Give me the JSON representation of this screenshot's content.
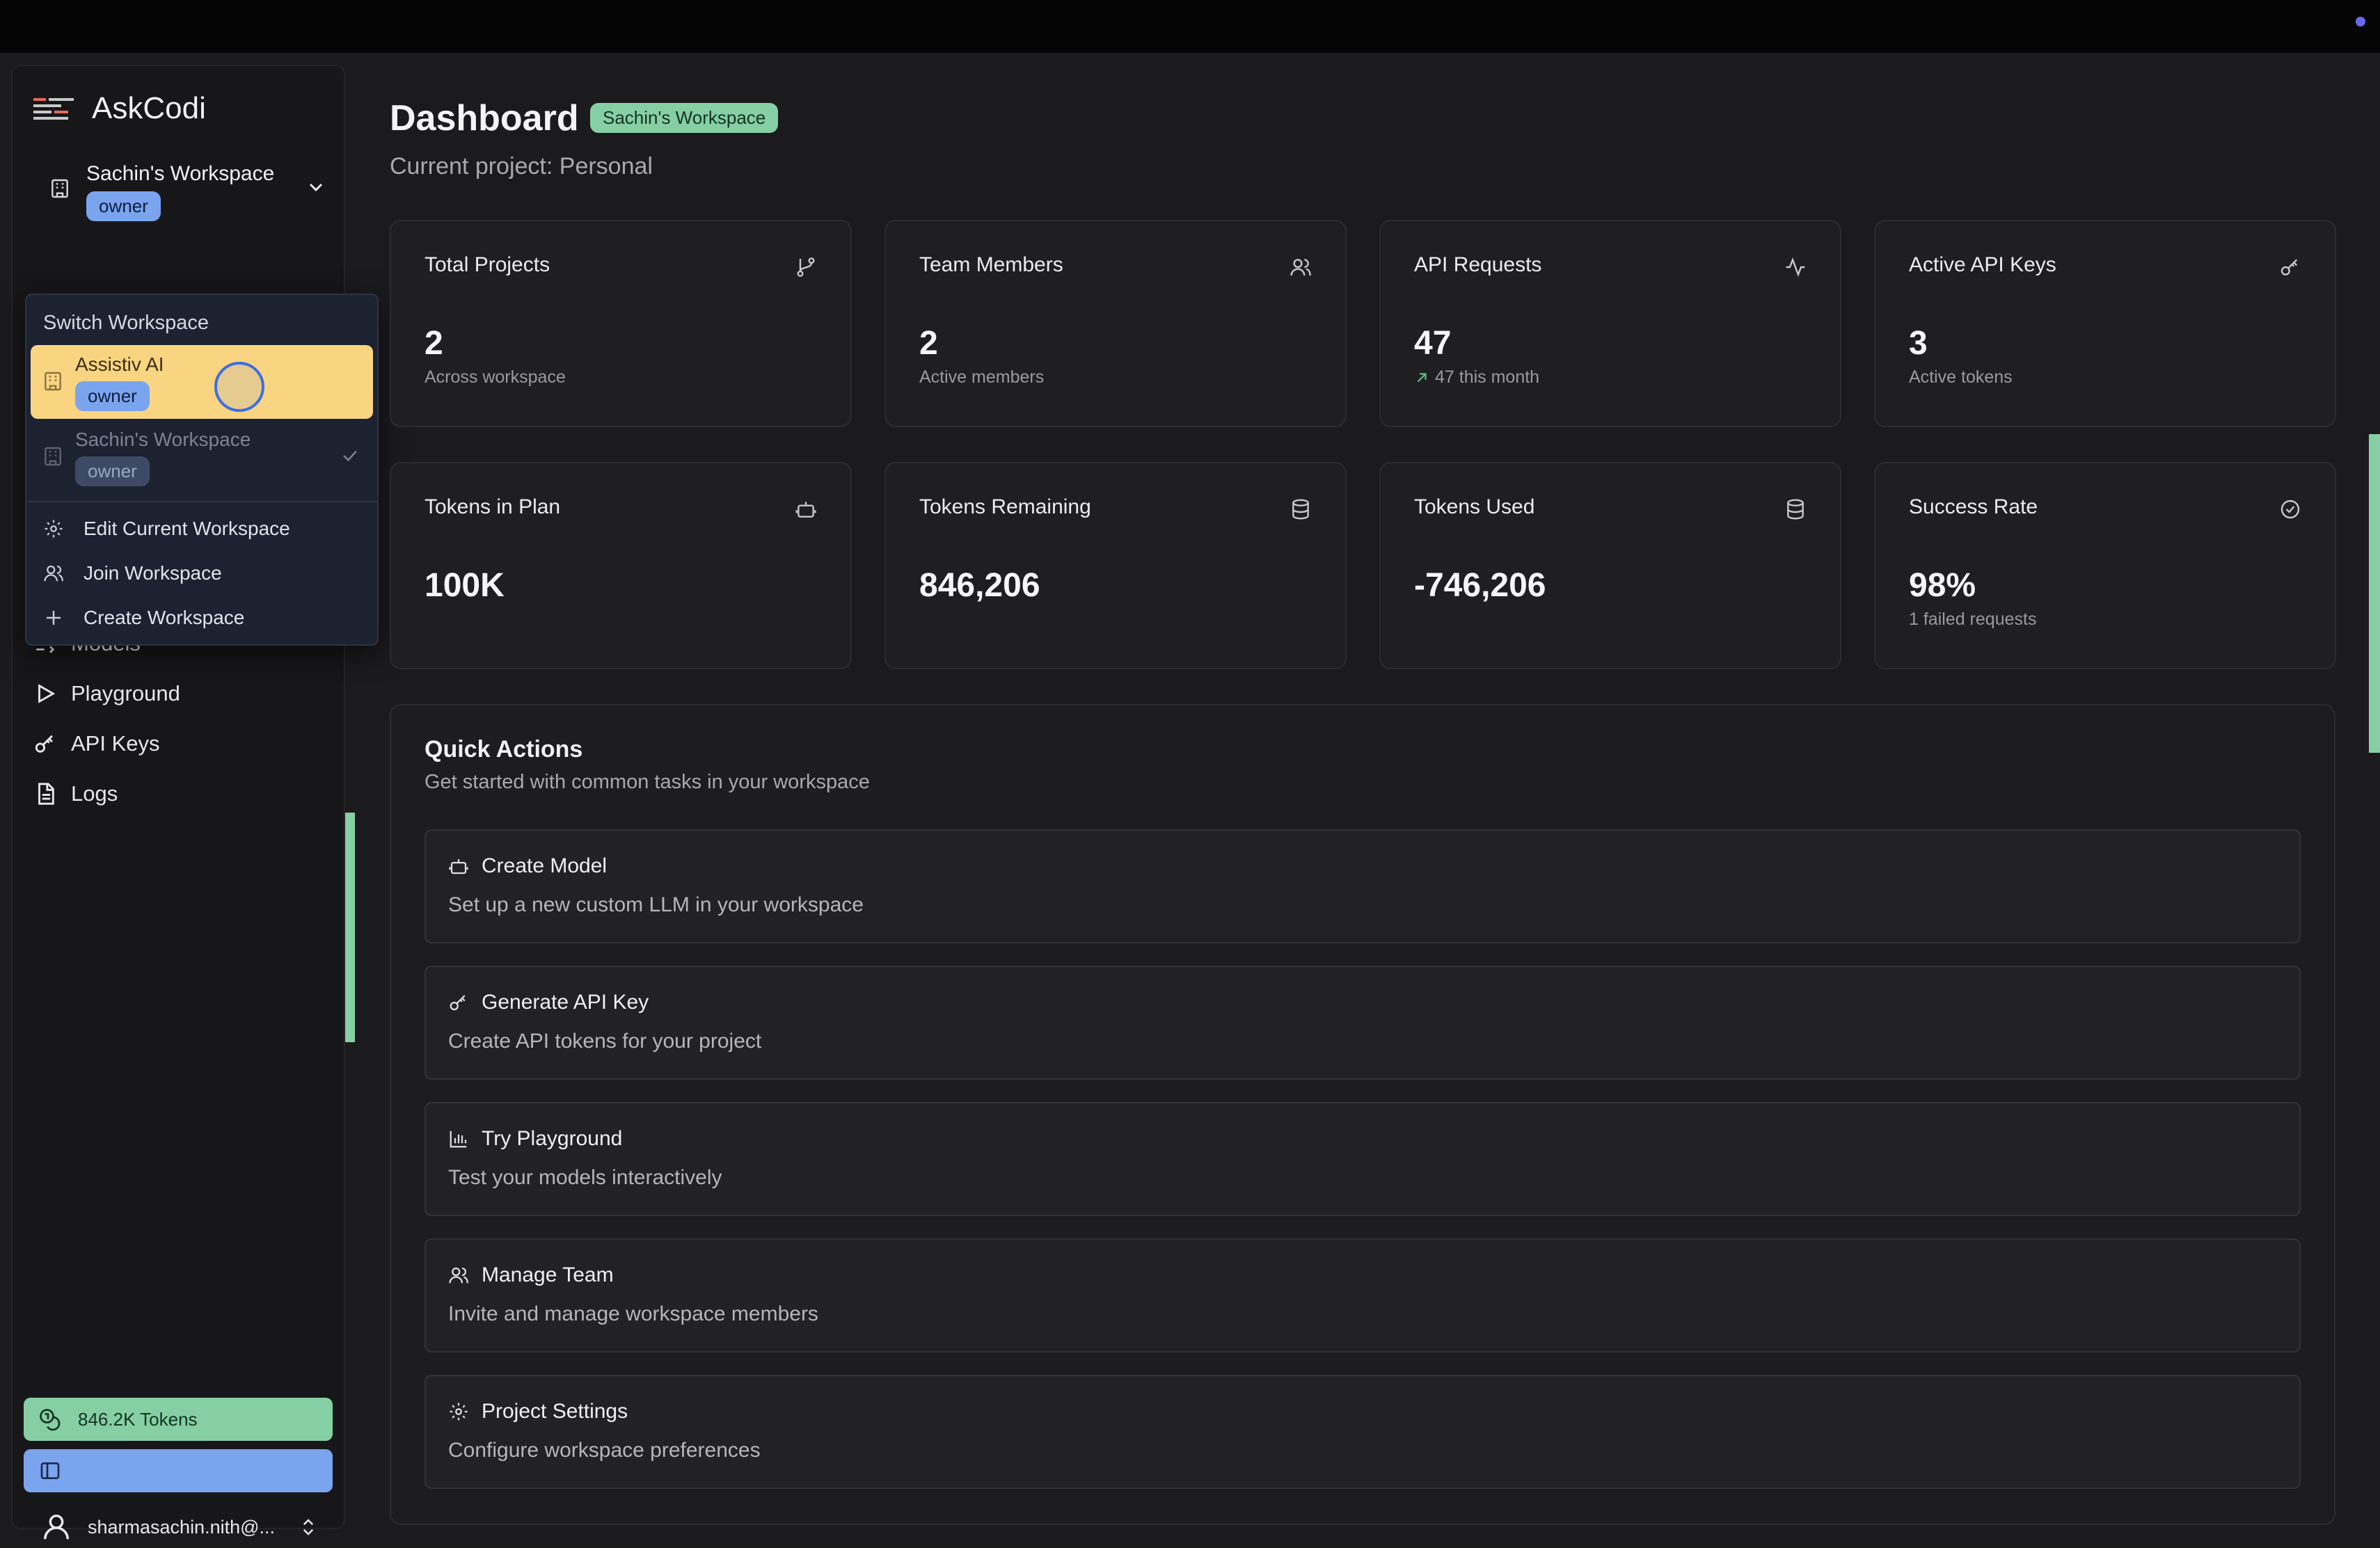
{
  "app": {
    "name": "AskCodi"
  },
  "workspace": {
    "name": "Sachin's Workspace",
    "role": "owner"
  },
  "dropdown": {
    "title": "Switch Workspace",
    "workspaces": [
      {
        "name": "Assistiv AI",
        "role": "owner"
      },
      {
        "name": "Sachin's Workspace",
        "role": "owner"
      }
    ],
    "actions": [
      "Edit Current Workspace",
      "Join Workspace",
      "Create Workspace"
    ]
  },
  "sidebar": {
    "items": [
      {
        "label": "Models",
        "icon": "models-icon"
      },
      {
        "label": "Playground",
        "icon": "play-icon"
      },
      {
        "label": "API Keys",
        "icon": "key-icon"
      },
      {
        "label": "Logs",
        "icon": "file-icon"
      }
    ],
    "tokens_label": "846.2K Tokens",
    "user_email": "sharmasachin.nith@..."
  },
  "header": {
    "title": "Dashboard",
    "badge": "Sachin's Workspace",
    "subtitle": "Current project: Personal"
  },
  "stats": [
    {
      "title": "Total Projects",
      "value": "2",
      "sub": "Across workspace",
      "icon": "git-branch-icon"
    },
    {
      "title": "Team Members",
      "value": "2",
      "sub": "Active members",
      "icon": "users-icon"
    },
    {
      "title": "API Requests",
      "value": "47",
      "sub": "47 this month",
      "icon": "activity-icon"
    },
    {
      "title": "Active API Keys",
      "value": "3",
      "sub": "Active tokens",
      "icon": "key-icon"
    },
    {
      "title": "Tokens in Plan",
      "value": "100K",
      "sub": "",
      "icon": "bot-icon"
    },
    {
      "title": "Tokens Remaining",
      "value": "846,206",
      "sub": "",
      "icon": "database-icon"
    },
    {
      "title": "Tokens Used",
      "value": "-746,206",
      "sub": "",
      "icon": "database-icon"
    },
    {
      "title": "Success Rate",
      "value": "98%",
      "sub": "1 failed requests",
      "icon": "check-circle-icon"
    }
  ],
  "quick_actions": {
    "title": "Quick Actions",
    "subtitle": "Get started with common tasks in your workspace",
    "items": [
      {
        "title": "Create Model",
        "desc": "Set up a new custom LLM in your workspace",
        "icon": "bot-icon"
      },
      {
        "title": "Generate API Key",
        "desc": "Create API tokens for your project",
        "icon": "key-icon"
      },
      {
        "title": "Try Playground",
        "desc": "Test your models interactively",
        "icon": "bar-chart-icon"
      },
      {
        "title": "Manage Team",
        "desc": "Invite and manage workspace members",
        "icon": "users-icon"
      },
      {
        "title": "Project Settings",
        "desc": "Configure workspace preferences",
        "icon": "gear-icon"
      }
    ]
  },
  "colors": {
    "accent_green": "#86cfa4",
    "accent_blue": "#7aa4ee",
    "highlight_yellow": "#fad581",
    "background": "#1b1b1d"
  }
}
